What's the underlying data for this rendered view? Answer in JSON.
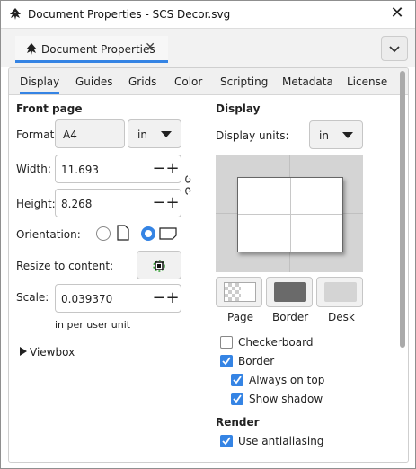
{
  "window": {
    "title": "Document Properties - SCS Decor.svg"
  },
  "dock": {
    "tab_label": "Document Properties"
  },
  "tabs": [
    {
      "label": "Display"
    },
    {
      "label": "Guides"
    },
    {
      "label": "Grids"
    },
    {
      "label": "Color"
    },
    {
      "label": "Scripting"
    },
    {
      "label": "Metadata"
    },
    {
      "label": "License"
    }
  ],
  "front_page": {
    "title": "Front page",
    "format_label": "Format:",
    "format_value": "A4",
    "unit_value": "in",
    "width_label": "Width:",
    "width_value": "11.693",
    "height_label": "Height:",
    "height_value": "8.268",
    "orientation_label": "Orientation:",
    "orientation_selected": "landscape",
    "resize_label": "Resize to content:",
    "scale_label": "Scale:",
    "scale_value": "0.039370",
    "scale_hint": "in per user unit",
    "viewbox_label": "Viewbox"
  },
  "display": {
    "title": "Display",
    "units_label": "Display units:",
    "units_value": "in",
    "swatches": [
      {
        "label": "Page"
      },
      {
        "label": "Border"
      },
      {
        "label": "Desk"
      }
    ],
    "checkboxes": [
      {
        "label": "Checkerboard",
        "checked": false
      },
      {
        "label": "Border",
        "checked": true
      },
      {
        "label": "Always on top",
        "checked": true
      },
      {
        "label": "Show shadow",
        "checked": true
      }
    ]
  },
  "render": {
    "title": "Render",
    "antialias_label": "Use antialiasing",
    "antialias_checked": true
  },
  "colors": {
    "accent": "#3584e4",
    "desk": "#d4d4d4",
    "border_swatch": "#6a6a6a"
  }
}
